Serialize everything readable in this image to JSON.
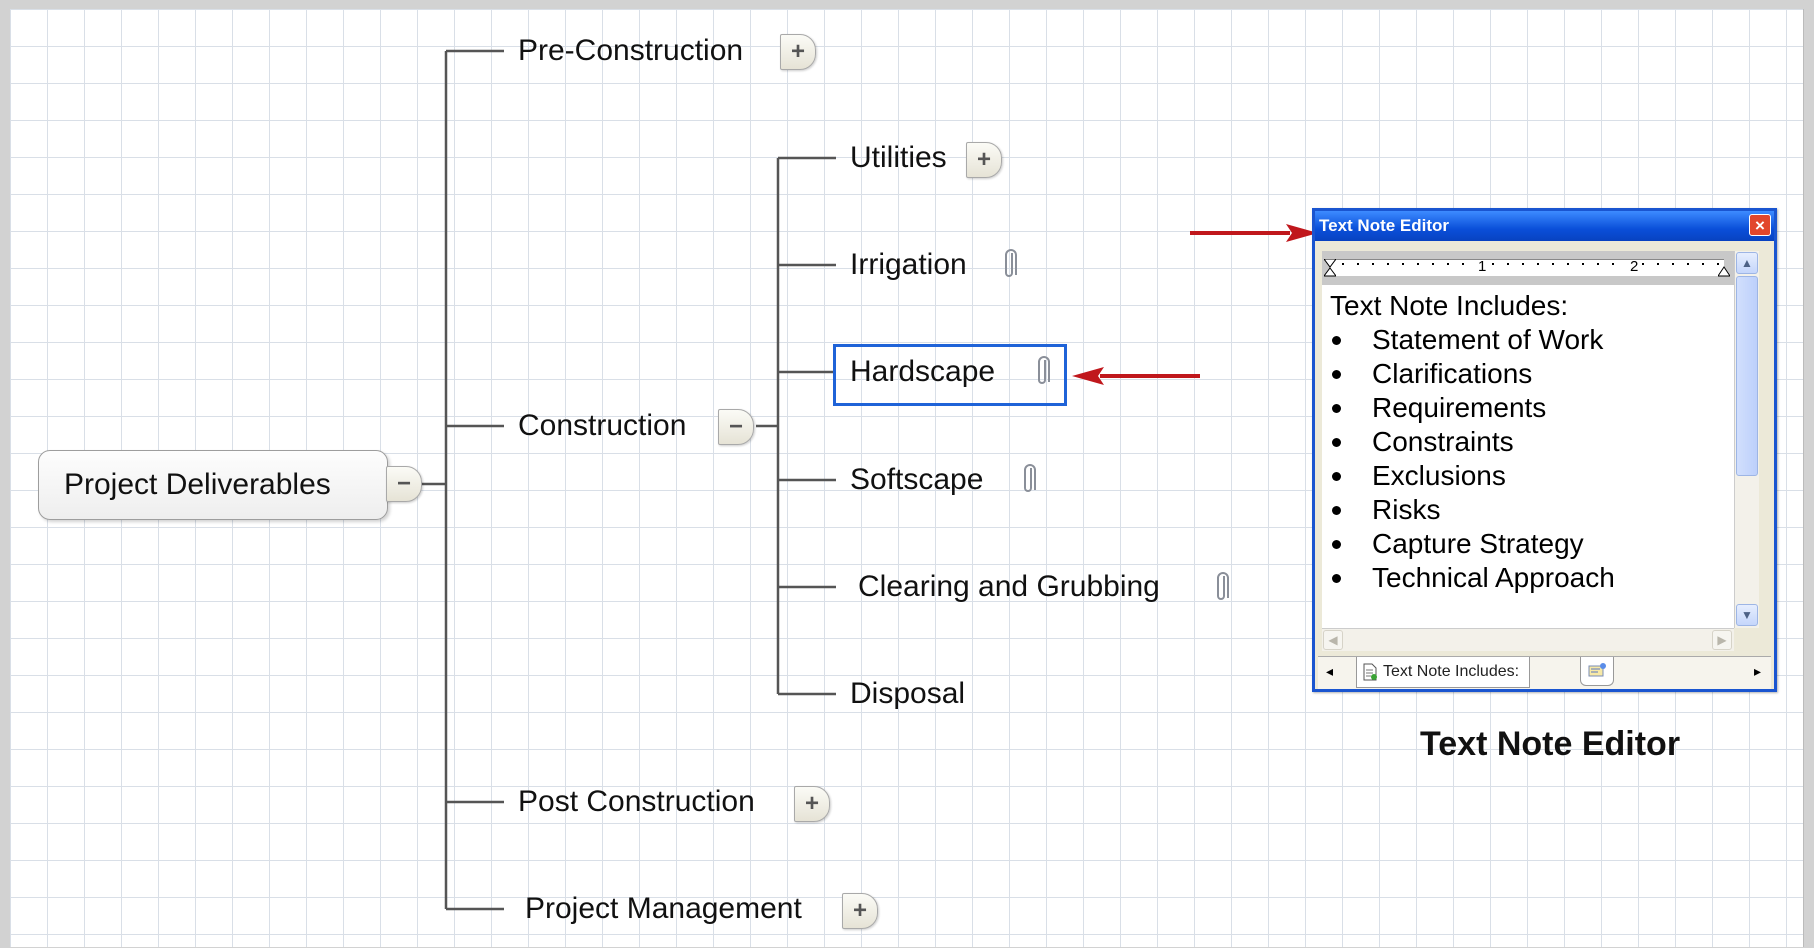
{
  "map": {
    "root": "Project Deliverables",
    "branches": [
      {
        "label": "Pre-Construction",
        "toggle": "+"
      },
      {
        "label": "Construction",
        "toggle": "−"
      },
      {
        "label": "Post Construction",
        "toggle": "+"
      },
      {
        "label": "Project Management",
        "toggle": "+"
      }
    ],
    "construction_children": [
      {
        "label": "Utilities",
        "toggle": "+"
      },
      {
        "label": "Irrigation",
        "attachment": "paperclip-icon"
      },
      {
        "label": "Hardscape",
        "attachment": "paperclip-icon",
        "selected": true
      },
      {
        "label": "Softscape",
        "attachment": "paperclip-icon"
      },
      {
        "label": "Clearing and Grubbing",
        "attachment": "paperclip-icon"
      },
      {
        "label": "Disposal"
      }
    ],
    "root_toggle": "−"
  },
  "editor": {
    "title": "Text Note Editor",
    "close": "×",
    "ruler": {
      "marks": [
        "1",
        "2"
      ]
    },
    "note": {
      "heading": "Text Note Includes:",
      "items": [
        "Statement of Work",
        "Clarifications",
        "Requirements",
        "Constraints",
        "Exclusions",
        "Risks",
        "Capture Strategy",
        "Technical Approach"
      ]
    },
    "tab_label": "Text Note Includes:",
    "tab_left": "◂",
    "tab_right": "▸"
  },
  "caption": "Text Note Editor",
  "colors": {
    "selection": "#1f63d8",
    "arrow": "#c0171c",
    "titlebar": "#0a4fd9",
    "grid": "#d9dfe7"
  }
}
